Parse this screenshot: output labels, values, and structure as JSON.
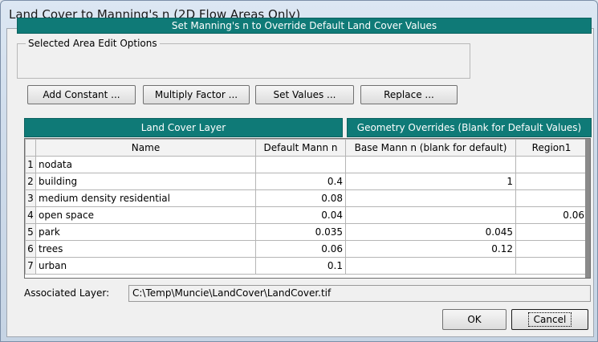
{
  "window": {
    "title": "Land Cover to Manning's n (2D Flow Areas Only)"
  },
  "banner": "Set Manning's n to Override Default Land Cover Values",
  "edit_options": {
    "legend": "Selected Area Edit Options",
    "buttons": {
      "add_constant": "Add Constant ...",
      "multiply_factor": "Multiply Factor ...",
      "set_values": "Set Values ...",
      "replace": "Replace ..."
    }
  },
  "headers": {
    "land_cover_layer": "Land Cover Layer",
    "geometry_overrides": "Geometry Overrides (Blank for Default Values)"
  },
  "table": {
    "columns": [
      "Name",
      "Default Mann n",
      "Base Mann n (blank for default)",
      "Region1"
    ],
    "rows": [
      {
        "num": "1",
        "name": "nodata",
        "default": "",
        "base": "",
        "region1": ""
      },
      {
        "num": "2",
        "name": "building",
        "default": "0.4",
        "base": "1",
        "region1": ""
      },
      {
        "num": "3",
        "name": "medium density residential",
        "default": "0.08",
        "base": "",
        "region1": ""
      },
      {
        "num": "4",
        "name": "open space",
        "default": "0.04",
        "base": "",
        "region1": "0.06"
      },
      {
        "num": "5",
        "name": "park",
        "default": "0.035",
        "base": "0.045",
        "region1": ""
      },
      {
        "num": "6",
        "name": "trees",
        "default": "0.06",
        "base": "0.12",
        "region1": ""
      },
      {
        "num": "7",
        "name": "urban",
        "default": "0.1",
        "base": "",
        "region1": ""
      }
    ]
  },
  "associated_layer": {
    "label": "Associated Layer:",
    "value": "C:\\Temp\\Muncie\\LandCover\\LandCover.tif"
  },
  "footer": {
    "ok": "OK",
    "cancel": "Cancel"
  },
  "colors": {
    "header_teal": "#0f7a77"
  }
}
